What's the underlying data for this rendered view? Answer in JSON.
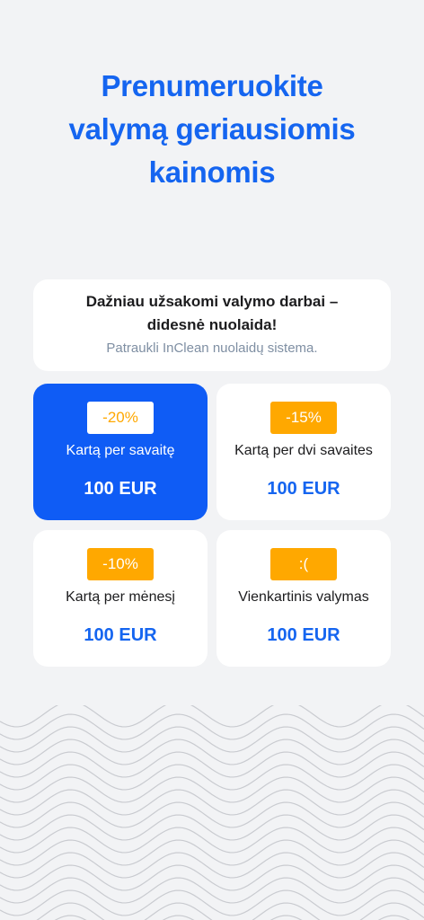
{
  "header": {
    "title_lines": [
      "Prenumeruokite",
      "valymą geriausiomis",
      "kainomis"
    ]
  },
  "info": {
    "title_line1": "Dažniau užsakomi valymo darbai –",
    "title_line2": "didesnė nuolaida!",
    "subtitle": "Patraukli InClean nuolaidų sistema."
  },
  "plans": [
    {
      "badge": "-20%",
      "label": "Kartą per savaitę",
      "price": "100 EUR",
      "selected": true
    },
    {
      "badge": "-15%",
      "label": "Kartą per dvi savaites",
      "price": "100 EUR",
      "selected": false
    },
    {
      "badge": "-10%",
      "label": "Kartą per mėnesį",
      "price": "100 EUR",
      "selected": false
    },
    {
      "badge": ":(",
      "label": "Vienkartinis valymas",
      "price": "100 EUR",
      "selected": false
    }
  ],
  "colors": {
    "accent": "#1565f0",
    "selected_card": "#0f5cf5",
    "badge": "#ffa800",
    "background": "#f2f3f5"
  }
}
